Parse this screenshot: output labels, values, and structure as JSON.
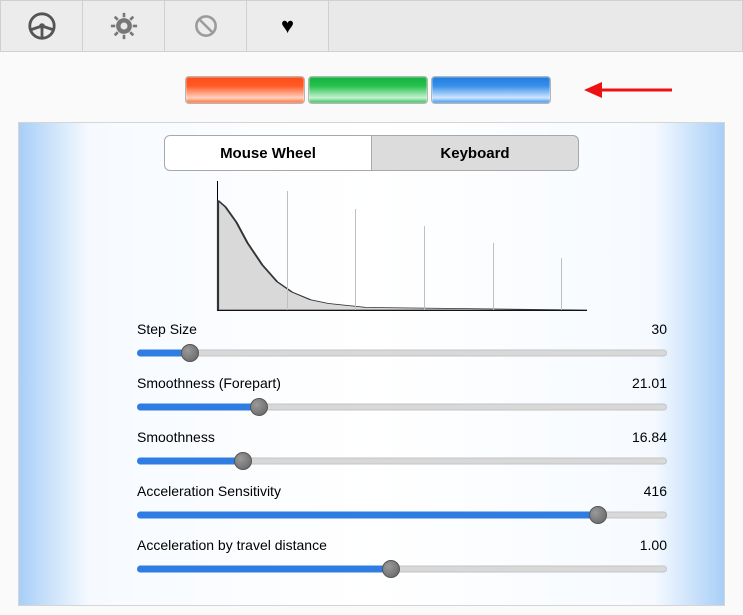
{
  "toolbar": {
    "items": [
      {
        "name": "steering-wheel-icon"
      },
      {
        "name": "gear-icon"
      },
      {
        "name": "disable-icon"
      },
      {
        "name": "heart-icon"
      }
    ]
  },
  "presets": {
    "items": [
      "orange",
      "green",
      "blue"
    ],
    "arrow_points_to": "blue"
  },
  "segments": {
    "mouse_wheel_label": "Mouse Wheel",
    "keyboard_label": "Keyboard",
    "selected": "keyboard"
  },
  "chart_data": {
    "type": "line",
    "xlabel": "",
    "ylabel": "",
    "x_range": [
      0,
      1
    ],
    "y_range": [
      0,
      1
    ],
    "description": "decaying-curve preview with vertical step markers",
    "curve": [
      {
        "x": 0.0,
        "y": 0.85
      },
      {
        "x": 0.02,
        "y": 0.8
      },
      {
        "x": 0.05,
        "y": 0.68
      },
      {
        "x": 0.08,
        "y": 0.52
      },
      {
        "x": 0.12,
        "y": 0.35
      },
      {
        "x": 0.16,
        "y": 0.22
      },
      {
        "x": 0.2,
        "y": 0.14
      },
      {
        "x": 0.25,
        "y": 0.08
      },
      {
        "x": 0.3,
        "y": 0.05
      },
      {
        "x": 0.4,
        "y": 0.02
      },
      {
        "x": 1.0,
        "y": 0.0
      }
    ],
    "markers": [
      {
        "x": 0.186,
        "h": 0.92
      },
      {
        "x": 0.372,
        "h": 0.78
      },
      {
        "x": 0.558,
        "h": 0.65
      },
      {
        "x": 0.744,
        "h": 0.52
      },
      {
        "x": 0.93,
        "h": 0.4
      }
    ]
  },
  "sliders": [
    {
      "label": "Step Size",
      "value_text": "30",
      "pct": 10
    },
    {
      "label": "Smoothness (Forepart)",
      "value_text": "21.01",
      "pct": 23
    },
    {
      "label": "Smoothness",
      "value_text": "16.84",
      "pct": 20
    },
    {
      "label": "Acceleration Sensitivity",
      "value_text": "416",
      "pct": 87
    },
    {
      "label": "Acceleration by travel distance",
      "value_text": "1.00",
      "pct": 48
    }
  ]
}
